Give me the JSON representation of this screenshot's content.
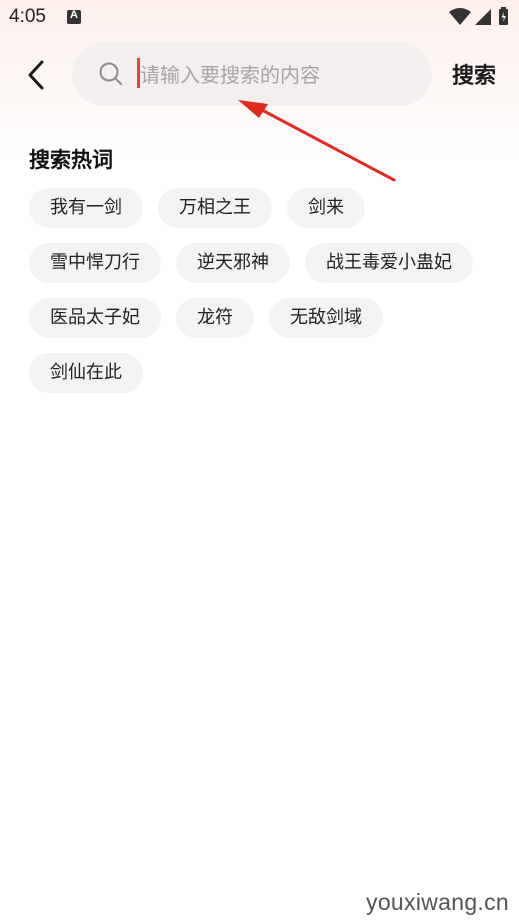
{
  "status_bar": {
    "time": "4:05",
    "notification_icon": "text-a-icon",
    "icons": [
      "wifi-icon",
      "signal-icon",
      "battery-icon"
    ]
  },
  "header": {
    "back_icon": "chevron-left-icon",
    "search_icon": "search-icon",
    "search_placeholder": "请输入要搜索的内容",
    "search_value": "",
    "search_button_label": "搜索"
  },
  "hot_words": {
    "title": "搜索热词",
    "rows": [
      [
        "我有一剑",
        "万相之王",
        "剑来"
      ],
      [
        "雪中悍刀行",
        "逆天邪神",
        "战王毒爱小蛊妃"
      ],
      [
        "医品太子妃",
        "龙符",
        "无敌剑域"
      ],
      [
        "剑仙在此"
      ]
    ]
  },
  "colors": {
    "accent": "#e8412f",
    "tag_bg": "#f3f3f3",
    "search_bg": "#f3efee"
  },
  "watermark": "youxiwang.cn"
}
